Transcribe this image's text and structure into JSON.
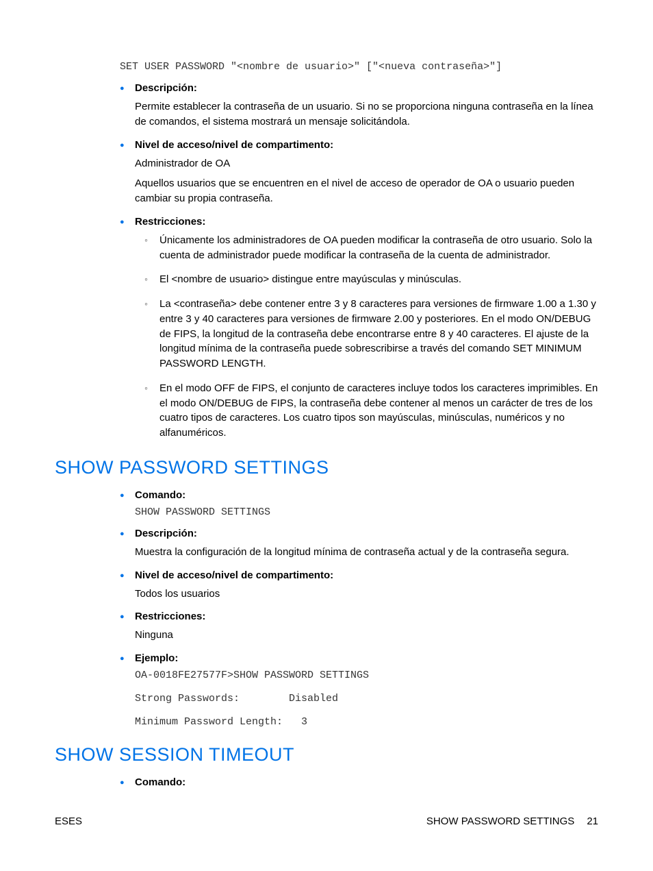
{
  "top_code": "SET USER PASSWORD \"<nombre de usuario>\" [\"<nueva contraseña>\"]",
  "section1": {
    "desc_label": "Descripción:",
    "desc_text": "Permite establecer la contraseña de un usuario. Si no se proporciona ninguna contraseña en la línea de comandos, el sistema mostrará un mensaje solicitándola.",
    "access_label": "Nivel de acceso/nivel de compartimento:",
    "access_text1": "Administrador de OA",
    "access_text2": "Aquellos usuarios que se encuentren en el nivel de acceso de operador de OA o usuario pueden cambiar su propia contraseña.",
    "restr_label": "Restricciones:",
    "restr_items": [
      "Únicamente los administradores de OA pueden modificar la contraseña de otro usuario. Solo la cuenta de administrador puede modificar la contraseña de la cuenta de administrador.",
      "El <nombre de usuario> distingue entre mayúsculas y minúsculas.",
      "La <contraseña> debe contener entre 3 y 8 caracteres para versiones de firmware 1.00 a 1.30 y entre 3 y 40 caracteres para versiones de firmware 2.00 y posteriores. En el modo ON/DEBUG de FIPS, la longitud de la contraseña debe encontrarse entre 8 y 40 caracteres. El ajuste de la longitud mínima de la contraseña puede sobrescribirse a través del comando SET MINIMUM PASSWORD LENGTH.",
      "En el modo OFF de FIPS, el conjunto de caracteres incluye todos los caracteres imprimibles. En el modo ON/DEBUG de FIPS, la contraseña debe contener al menos un carácter de tres de los cuatro tipos de caracteres. Los cuatro tipos son mayúsculas, minúsculas, numéricos y no alfanuméricos."
    ]
  },
  "heading1": "SHOW PASSWORD SETTINGS",
  "section2": {
    "cmd_label": "Comando:",
    "cmd_code": "SHOW PASSWORD SETTINGS",
    "desc_label": "Descripción:",
    "desc_text": "Muestra la configuración de la longitud mínima de contraseña actual y de la contraseña segura.",
    "access_label": "Nivel de acceso/nivel de compartimento:",
    "access_text": "Todos los usuarios",
    "restr_label": "Restricciones:",
    "restr_text": "Ninguna",
    "ex_label": "Ejemplo:",
    "ex_code": "OA-0018FE27577F>SHOW PASSWORD SETTINGS\n\nStrong Passwords:        Disabled\n\nMinimum Password Length:   3"
  },
  "heading2": "SHOW SESSION TIMEOUT",
  "section3": {
    "cmd_label": "Comando:"
  },
  "footer": {
    "left": "ESES",
    "right_section": "SHOW PASSWORD SETTINGS",
    "right_page": "21"
  }
}
